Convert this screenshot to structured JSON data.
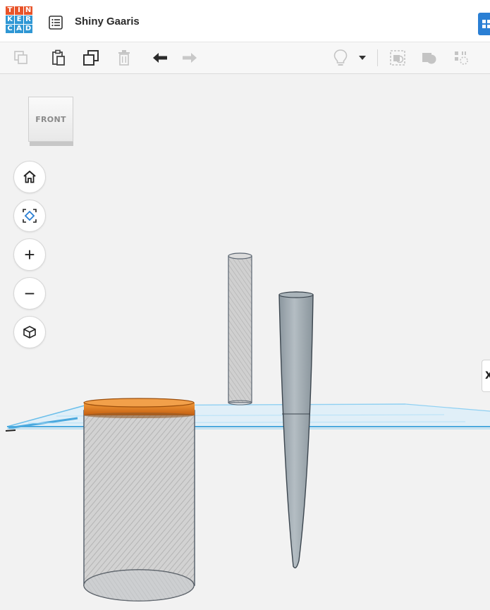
{
  "app": {
    "name": "Tinkercad",
    "logo_letters": [
      "T",
      "I",
      "N",
      "K",
      "E",
      "R",
      "C",
      "A",
      "D"
    ],
    "logo_colors": [
      "#e8542a",
      "#e8542a",
      "#e8542a",
      "#2f97d4",
      "#2f97d4",
      "#2f97d4",
      "#2f97d4",
      "#2f97d4",
      "#2f97d4"
    ],
    "design_title": "Shiny Gaaris",
    "accent": "#2a7fd4"
  },
  "toolbar": {
    "copy_icon": "copy-icon",
    "paste_icon": "paste-icon",
    "duplicate_icon": "duplicate-icon",
    "delete_icon": "trash-icon",
    "undo_icon": "undo-arrow-icon",
    "redo_icon": "redo-arrow-icon",
    "light_icon": "lightbulb-icon",
    "dropdown_icon": "caret-down-icon",
    "group_icon": "group-icon",
    "ungroup_icon": "ungroup-icon",
    "align_icon": "align-icon"
  },
  "viewport": {
    "viewcube_label": "FRONT",
    "nav_buttons": [
      "home-icon",
      "fit-view-icon",
      "zoom-in-icon",
      "zoom-out-icon",
      "perspective-icon"
    ],
    "zoom_in_glyph": "+",
    "zoom_out_glyph": "−",
    "side_tab_glyph": "X",
    "workplane_color": "#a9dcf5",
    "solid_color": "#9aa5ad",
    "hole_color": "#c9c9c9",
    "selected_color": "#e07b1c"
  }
}
